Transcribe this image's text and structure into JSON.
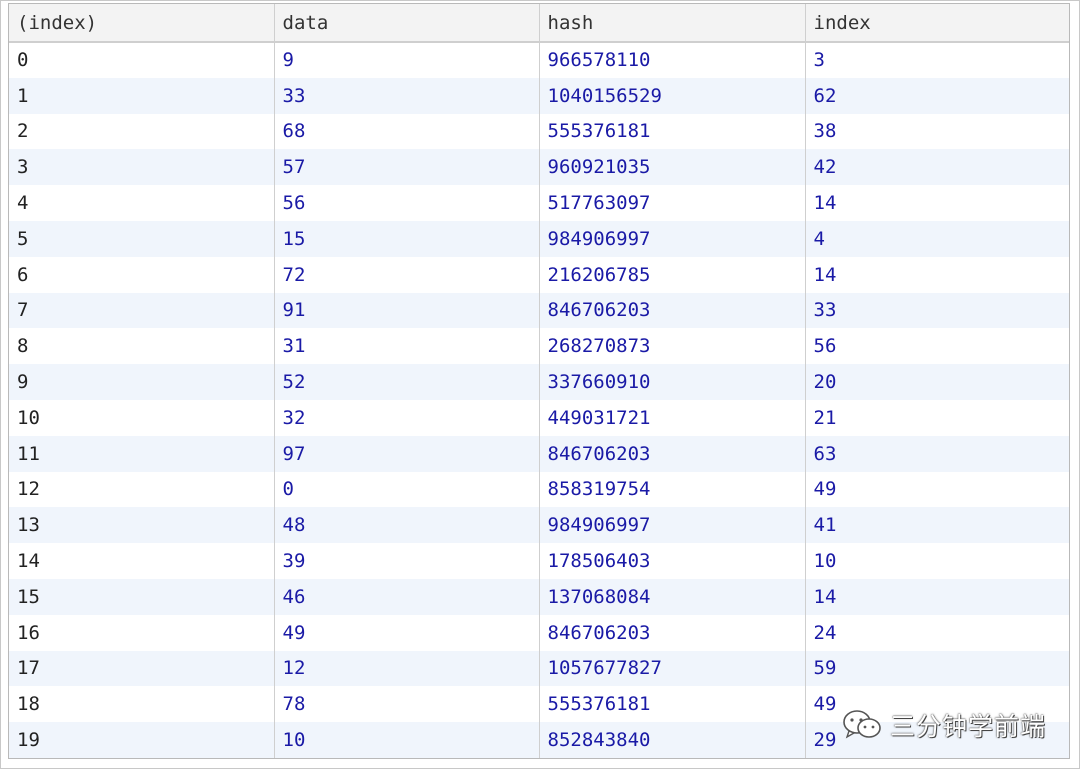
{
  "table": {
    "columns": [
      "(index)",
      "data",
      "hash",
      "index"
    ],
    "rows": [
      [
        "0",
        "9",
        "966578110",
        "3"
      ],
      [
        "1",
        "33",
        "1040156529",
        "62"
      ],
      [
        "2",
        "68",
        "555376181",
        "38"
      ],
      [
        "3",
        "57",
        "960921035",
        "42"
      ],
      [
        "4",
        "56",
        "517763097",
        "14"
      ],
      [
        "5",
        "15",
        "984906997",
        "4"
      ],
      [
        "6",
        "72",
        "216206785",
        "14"
      ],
      [
        "7",
        "91",
        "846706203",
        "33"
      ],
      [
        "8",
        "31",
        "268270873",
        "56"
      ],
      [
        "9",
        "52",
        "337660910",
        "20"
      ],
      [
        "10",
        "32",
        "449031721",
        "21"
      ],
      [
        "11",
        "97",
        "846706203",
        "63"
      ],
      [
        "12",
        "0",
        "858319754",
        "49"
      ],
      [
        "13",
        "48",
        "984906997",
        "41"
      ],
      [
        "14",
        "39",
        "178506403",
        "10"
      ],
      [
        "15",
        "46",
        "137068084",
        "14"
      ],
      [
        "16",
        "49",
        "846706203",
        "24"
      ],
      [
        "17",
        "12",
        "1057677827",
        "59"
      ],
      [
        "18",
        "78",
        "555376181",
        "49"
      ],
      [
        "19",
        "10",
        "852843840",
        "29"
      ]
    ]
  },
  "watermark": {
    "text": "三分钟学前端",
    "icon": "wechat-icon"
  },
  "colors": {
    "value_text": "#1a1aa6",
    "index_text": "#222222",
    "stripe": "#f0f5fc",
    "header_bg": "#f3f3f3"
  }
}
